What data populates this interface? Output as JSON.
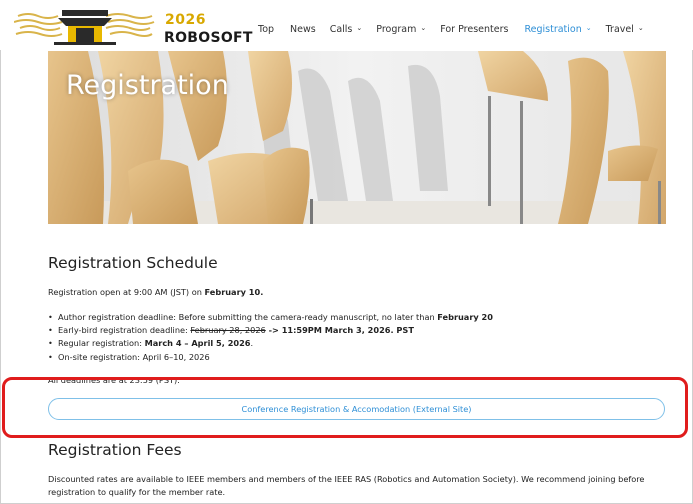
{
  "header": {
    "logo_year": "2026",
    "logo_name": "ROBOSOFT",
    "nav": [
      {
        "label": "Top",
        "dropdown": false,
        "active": false
      },
      {
        "label": "News",
        "dropdown": false,
        "active": false
      },
      {
        "label": "Calls",
        "dropdown": true,
        "active": false
      },
      {
        "label": "Program",
        "dropdown": true,
        "active": false
      },
      {
        "label": "For Presenters",
        "dropdown": false,
        "active": false
      },
      {
        "label": "Registration",
        "dropdown": true,
        "active": true
      },
      {
        "label": "Travel",
        "dropdown": true,
        "active": false
      }
    ],
    "accent_color": "#2e8fd6"
  },
  "hero": {
    "title": "Registration"
  },
  "schedule": {
    "heading": "Registration Schedule",
    "open_prefix": "Registration open at 9:00 AM (JST) on ",
    "open_date": "February 10.",
    "items": {
      "author_prefix": "Author registration deadline: Before submitting the camera-ready manuscript, no later than ",
      "author_date": "February 20",
      "early_prefix": "Early-bird registration deadline: ",
      "early_old": "February 28, 2026",
      "early_new": " -> 11:59PM March 3, 2026. PST",
      "regular_prefix": "Regular registration: ",
      "regular_dates": "March 4 – April 5, 2026",
      "regular_suffix": ".",
      "onsite": "On-site registration: April 6–10, 2026"
    },
    "deadline_note": "All deadlines are at 23:59 (PST)."
  },
  "cta": {
    "label": "Conference Registration & Accomodation (External Site)"
  },
  "fees": {
    "heading": "Registration Fees",
    "text_line1": "Discounted rates are available to IEEE members and members of the IEEE RAS (Robotics and Automation Society). We recommend joining before",
    "text_line2": "registration to qualify for the member rate."
  }
}
